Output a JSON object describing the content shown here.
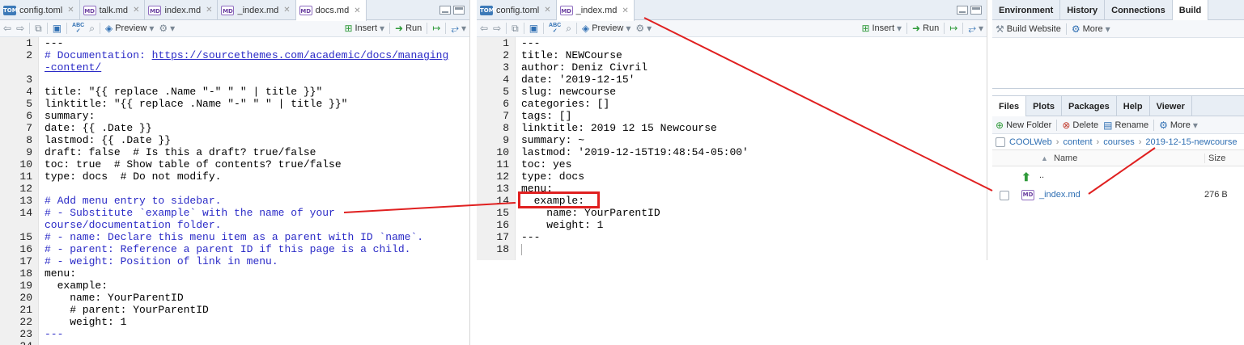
{
  "left_editor": {
    "tabs": [
      {
        "icon": "TOML",
        "label": "config.toml",
        "active": false
      },
      {
        "icon": "MD",
        "label": "talk.md",
        "active": false
      },
      {
        "icon": "MD",
        "label": "index.md",
        "active": false
      },
      {
        "icon": "MD",
        "label": "_index.md",
        "active": false
      },
      {
        "icon": "MD",
        "label": "docs.md",
        "active": true
      }
    ],
    "toolbar": {
      "preview": "Preview",
      "insert": "Insert",
      "run": "Run"
    },
    "lines": [
      {
        "n": "1",
        "text": "---",
        "style": "plain"
      },
      {
        "n": "2",
        "text": "# Documentation: ",
        "url": "https://sourcethemes.com/academic/docs/managing",
        "style": "comment"
      },
      {
        "n": "",
        "text": "",
        "url": "-content/",
        "style": "comment"
      },
      {
        "n": "3",
        "text": "",
        "style": "plain"
      },
      {
        "n": "4",
        "text": "title: \"{{ replace .Name \"-\" \" \" | title }}\"",
        "style": "plain"
      },
      {
        "n": "5",
        "text": "linktitle: \"{{ replace .Name \"-\" \" \" | title }}\"",
        "style": "plain"
      },
      {
        "n": "6",
        "text": "summary:",
        "style": "plain"
      },
      {
        "n": "7",
        "text": "date: {{ .Date }}",
        "style": "plain"
      },
      {
        "n": "8",
        "text": "lastmod: {{ .Date }}",
        "style": "plain"
      },
      {
        "n": "9",
        "text": "draft: false  # Is this a draft? true/false",
        "style": "plain"
      },
      {
        "n": "10",
        "text": "toc: true  # Show table of contents? true/false",
        "style": "plain"
      },
      {
        "n": "11",
        "text": "type: docs  # Do not modify.",
        "style": "plain"
      },
      {
        "n": "12",
        "text": "",
        "style": "plain"
      },
      {
        "n": "13",
        "text": "# Add menu entry to sidebar.",
        "style": "comment"
      },
      {
        "n": "14",
        "text": "# - Substitute `example` with the name of your",
        "style": "comment"
      },
      {
        "n": "",
        "text": "course/documentation folder.",
        "style": "comment"
      },
      {
        "n": "15",
        "text": "# - name: Declare this menu item as a parent with ID `name`.",
        "style": "comment"
      },
      {
        "n": "16",
        "text": "# - parent: Reference a parent ID if this page is a child.",
        "style": "comment"
      },
      {
        "n": "17",
        "text": "# - weight: Position of link in menu.",
        "style": "comment"
      },
      {
        "n": "18",
        "text": "menu:",
        "style": "plain"
      },
      {
        "n": "19",
        "text": "  example:",
        "style": "plain"
      },
      {
        "n": "20",
        "text": "    name: YourParentID",
        "style": "plain"
      },
      {
        "n": "21",
        "text": "    # parent: YourParentID",
        "style": "plain"
      },
      {
        "n": "22",
        "text": "    weight: 1",
        "style": "plain"
      },
      {
        "n": "23",
        "text": "---",
        "style": "comment"
      },
      {
        "n": "24",
        "text": "",
        "style": "plain"
      }
    ]
  },
  "mid_editor": {
    "tabs": [
      {
        "icon": "TOML",
        "label": "config.toml",
        "active": false
      },
      {
        "icon": "MD",
        "label": "_index.md",
        "active": true
      }
    ],
    "toolbar": {
      "preview": "Preview",
      "insert": "Insert",
      "run": "Run"
    },
    "lines": [
      {
        "n": "1",
        "text": "---"
      },
      {
        "n": "2",
        "text": "title: NEWCourse"
      },
      {
        "n": "3",
        "text": "author: Deniz Civril"
      },
      {
        "n": "4",
        "text": "date: '2019-12-15'"
      },
      {
        "n": "5",
        "text": "slug: newcourse"
      },
      {
        "n": "6",
        "text": "categories: []"
      },
      {
        "n": "7",
        "text": "tags: []"
      },
      {
        "n": "8",
        "text": "linktitle: 2019 12 15 Newcourse"
      },
      {
        "n": "9",
        "text": "summary: ~"
      },
      {
        "n": "10",
        "text": "lastmod: '2019-12-15T19:48:54-05:00'"
      },
      {
        "n": "11",
        "text": "toc: yes"
      },
      {
        "n": "12",
        "text": "type: docs"
      },
      {
        "n": "13",
        "text": "menu:"
      },
      {
        "n": "14",
        "text": "  example:"
      },
      {
        "n": "15",
        "text": "    name: YourParentID"
      },
      {
        "n": "16",
        "text": "    weight: 1"
      },
      {
        "n": "17",
        "text": "---"
      },
      {
        "n": "18",
        "text": ""
      }
    ]
  },
  "env_panel": {
    "tabs": [
      {
        "label": "Environment",
        "active": false
      },
      {
        "label": "History",
        "active": false
      },
      {
        "label": "Connections",
        "active": false
      },
      {
        "label": "Build",
        "active": true
      }
    ],
    "build_website": "Build Website",
    "more": "More"
  },
  "files_panel": {
    "tabs": [
      {
        "label": "Files",
        "active": true
      },
      {
        "label": "Plots",
        "active": false
      },
      {
        "label": "Packages",
        "active": false
      },
      {
        "label": "Help",
        "active": false
      },
      {
        "label": "Viewer",
        "active": false
      }
    ],
    "toolbar": {
      "new_folder": "New Folder",
      "delete": "Delete",
      "rename": "Rename",
      "more": "More"
    },
    "breadcrumb": [
      "COOLWeb",
      "content",
      "courses",
      "2019-12-15-newcourse"
    ],
    "columns": {
      "name": "Name",
      "size": "Size"
    },
    "up_label": "..",
    "files": [
      {
        "icon": "MD",
        "name": "_index.md",
        "size": "276 B"
      }
    ]
  },
  "annotation_color": "#e02020"
}
